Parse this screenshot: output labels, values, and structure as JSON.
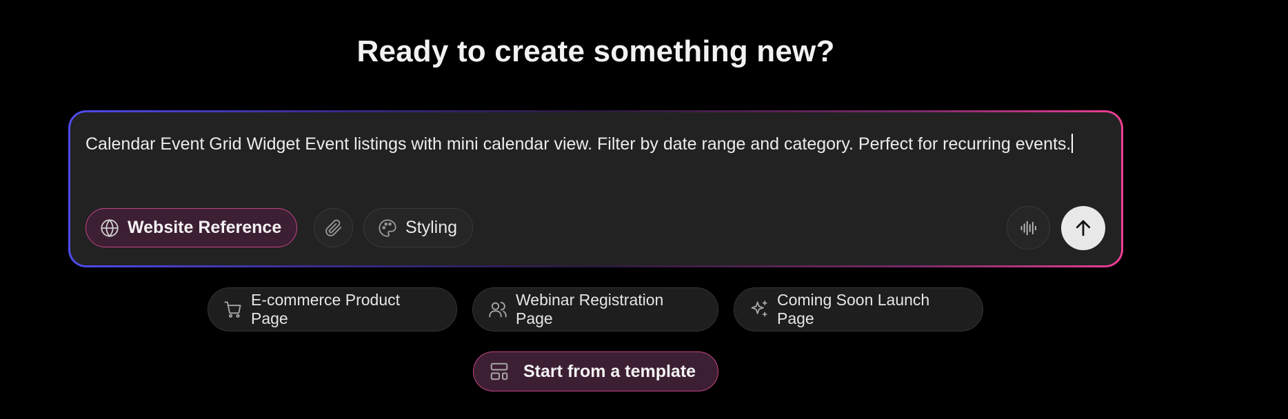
{
  "headline": "Ready to create something new?",
  "composer": {
    "prompt_value": "Calendar Event Grid Widget Event listings with mini calendar view. Filter by date range and category. Perfect for recurring events."
  },
  "toolbar": {
    "website_reference_label": "Website Reference",
    "styling_label": "Styling",
    "icons": {
      "website_reference": "globe-icon",
      "attach": "paperclip-icon",
      "styling": "palette-icon",
      "voice": "audio-waveform-icon",
      "send": "arrow-up-icon"
    }
  },
  "suggestions": [
    {
      "label": "E-commerce Product Page",
      "icon": "shopping-cart-icon"
    },
    {
      "label": "Webinar Registration Page",
      "icon": "users-icon"
    },
    {
      "label": "Coming Soon Launch Page",
      "icon": "sparkles-icon"
    }
  ],
  "template": {
    "label": "Start from a template",
    "icon": "layout-template-icon"
  },
  "colors": {
    "background": "#000000",
    "composer_bg": "#222222",
    "gradient_start": "#4f4cf0",
    "gradient_end": "#ee3f95",
    "accent_pill_bg": "#3d1f33",
    "accent_pill_border": "#c44585",
    "send_button_bg": "#e8e8e8"
  }
}
